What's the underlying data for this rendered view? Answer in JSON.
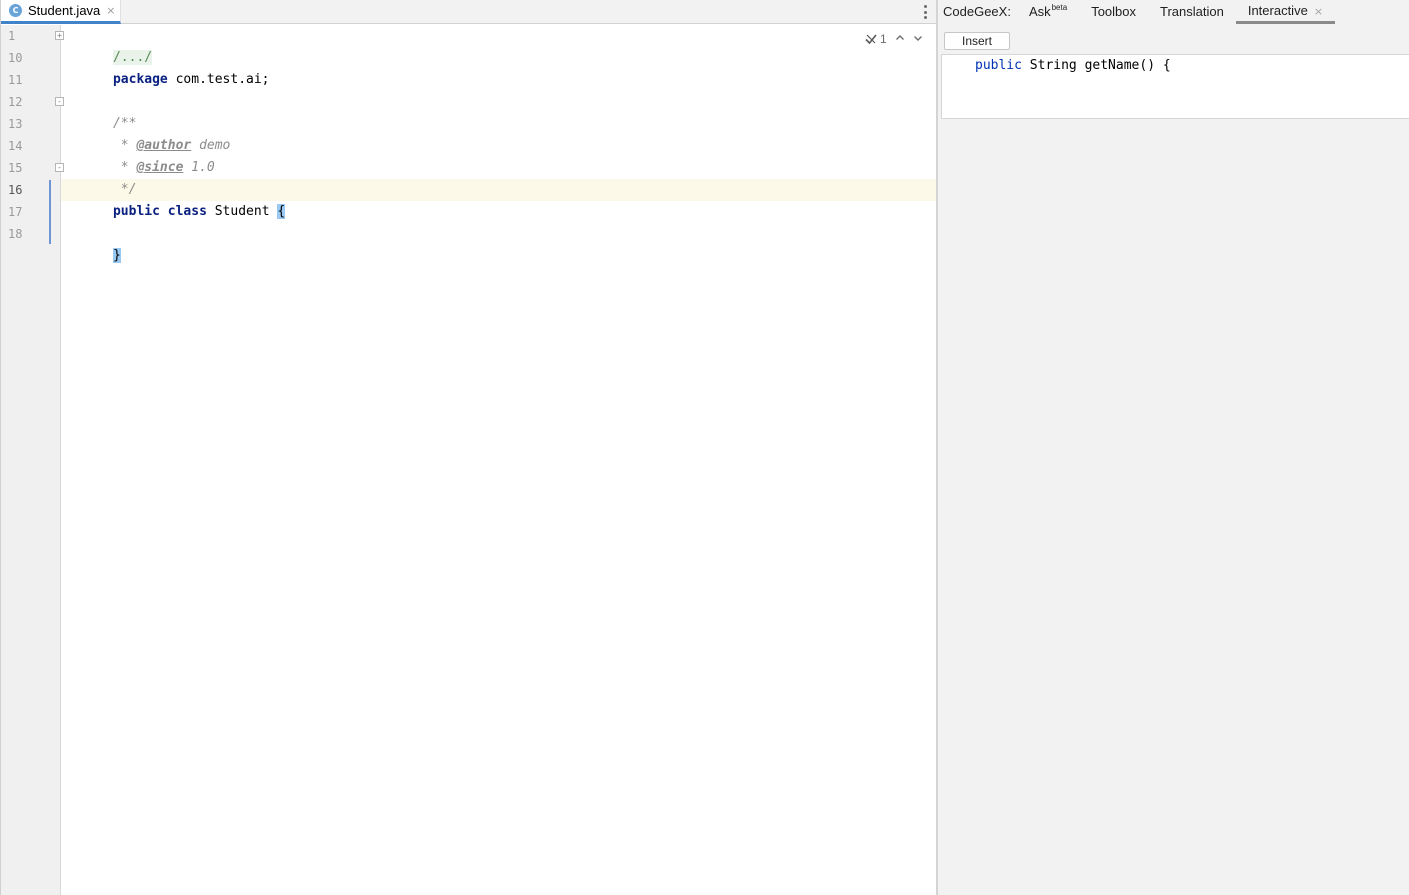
{
  "editor": {
    "file_tab": {
      "icon": "class-icon",
      "icon_letter": "C",
      "label": "Student.java",
      "close": "×"
    },
    "inspection": {
      "check_icon": "check-icon",
      "count": "1",
      "up": "⌃",
      "down": "⌄"
    },
    "line_numbers": [
      "1",
      "10",
      "11",
      "12",
      "13",
      "14",
      "15",
      "16",
      "17",
      "18"
    ],
    "current_line_number": "16",
    "lines": {
      "l1_folded": "/.../",
      "l10_kw": "package",
      "l10_rest": " com.test.ai;",
      "l12": "/**",
      "l13_prefix": " * ",
      "l13_tag": "@author",
      "l13_value": " demo",
      "l14_prefix": " * ",
      "l14_tag": "@since",
      "l14_value": " 1.0",
      "l15": " */",
      "l16_kw1": "public",
      "l16_kw2": "class",
      "l16_name": " Student ",
      "l16_brace": "{",
      "l18_brace": "}"
    }
  },
  "panel": {
    "tabs": [
      {
        "label": "CodeGeeX:"
      },
      {
        "label": "Ask",
        "sup": "beta"
      },
      {
        "label": "Toolbox"
      },
      {
        "label": "Translation"
      },
      {
        "label": "Interactive",
        "close": "×",
        "active": true
      }
    ],
    "insert_label": "Insert",
    "snippet": {
      "kw": "public",
      "rest": " String getName() {"
    }
  }
}
